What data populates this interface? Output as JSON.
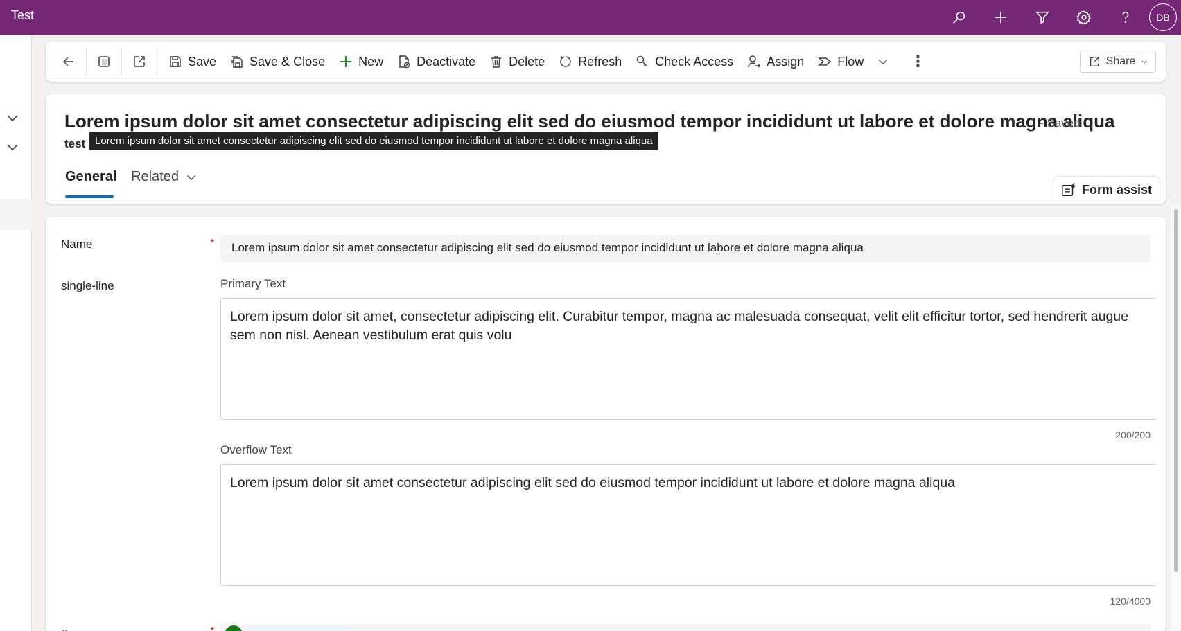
{
  "app": {
    "title": "Test",
    "user_initials": "DB"
  },
  "topbar": {
    "icons": [
      "search-icon",
      "plus-icon",
      "filter-icon",
      "settings-icon",
      "help-icon"
    ]
  },
  "commands": {
    "save": "Save",
    "save_close": "Save & Close",
    "new": "New",
    "deactivate": "Deactivate",
    "delete": "Delete",
    "refresh": "Refresh",
    "check_access": "Check Access",
    "assign": "Assign",
    "flow": "Flow",
    "share": "Share"
  },
  "record": {
    "title": "Lorem ipsum dolor sit amet consectetur adipiscing elit sed do eiusmod tempor incididunt ut labore et dolore magna aliqua",
    "save_status": "- Saved",
    "entity": "test",
    "tooltip": "Lorem ipsum dolor sit amet consectetur adipiscing elit sed do eiusmod tempor incididunt ut labore et dolore magna aliqua"
  },
  "tabs": {
    "general": "General",
    "related": "Related",
    "form_assist": "Form assist"
  },
  "form": {
    "name_label": "Name",
    "name_value": "Lorem ipsum dolor sit amet consectetur adipiscing elit sed do eiusmod tempor incididunt ut labore et dolore magna aliqua",
    "single_line_label": "single-line",
    "primary_label": "Primary Text",
    "primary_value": "Lorem ipsum dolor sit amet, consectetur adipiscing elit. Curabitur tempor, magna ac malesuada consequat, velit elit efficitur tortor, sed hendrerit augue sem non nisl. Aenean vestibulum erat quis volu",
    "primary_counter": "200/200",
    "overflow_label": "Overflow Text",
    "overflow_value": "Lorem ipsum dolor sit amet consectetur adipiscing elit sed do eiusmod tempor incididunt ut labore et dolore magna aliqua",
    "overflow_counter": "120/4000",
    "required_marker": "*"
  }
}
